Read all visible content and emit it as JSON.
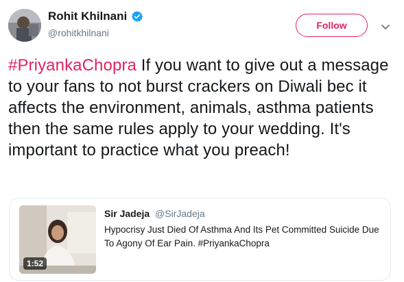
{
  "author": {
    "display_name": "Rohit Khilnani",
    "handle": "@rohitkhilnani",
    "verified": true
  },
  "actions": {
    "follow_label": "Follow"
  },
  "tweet": {
    "hashtag": "#PriyankaChopra",
    "body": " If you want to give out a message to your fans to not burst crackers on Diwali bec it affects the environment, animals, asthma patients then the same rules apply to your wedding. It's important to practice what you preach!"
  },
  "quoted_tweet": {
    "display_name": "Sir Jadeja",
    "handle": "@SirJadeja",
    "text": "Hypocrisy Just Died Of Asthma And Its Pet Committed Suicide Due To Agony Of Ear Pain. #PriyankaChopra",
    "video_duration": "1:52"
  },
  "colors": {
    "accent": "#e0245e",
    "verified_blue": "#1da1f2",
    "secondary_text": "#657786",
    "border": "#e6ecf0"
  },
  "icons": {
    "verified": "verified-badge-icon",
    "more": "chevron-down-icon"
  }
}
